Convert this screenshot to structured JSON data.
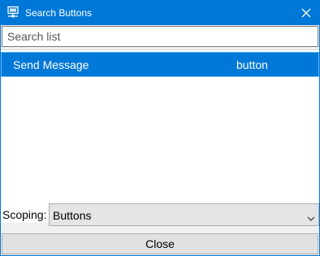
{
  "window": {
    "title": "Search Buttons",
    "icon": "network-computer-icon",
    "close_icon": "close-icon",
    "accent_color": "#0078d7"
  },
  "search": {
    "placeholder": "Search list",
    "value": ""
  },
  "list": {
    "items": [
      {
        "name": "Send Message",
        "type": "button",
        "selected": true
      }
    ]
  },
  "scoping": {
    "label": "Scoping:",
    "selected": "Buttons",
    "chevron_icon": "chevron-down-icon"
  },
  "footer": {
    "close_label": "Close"
  }
}
